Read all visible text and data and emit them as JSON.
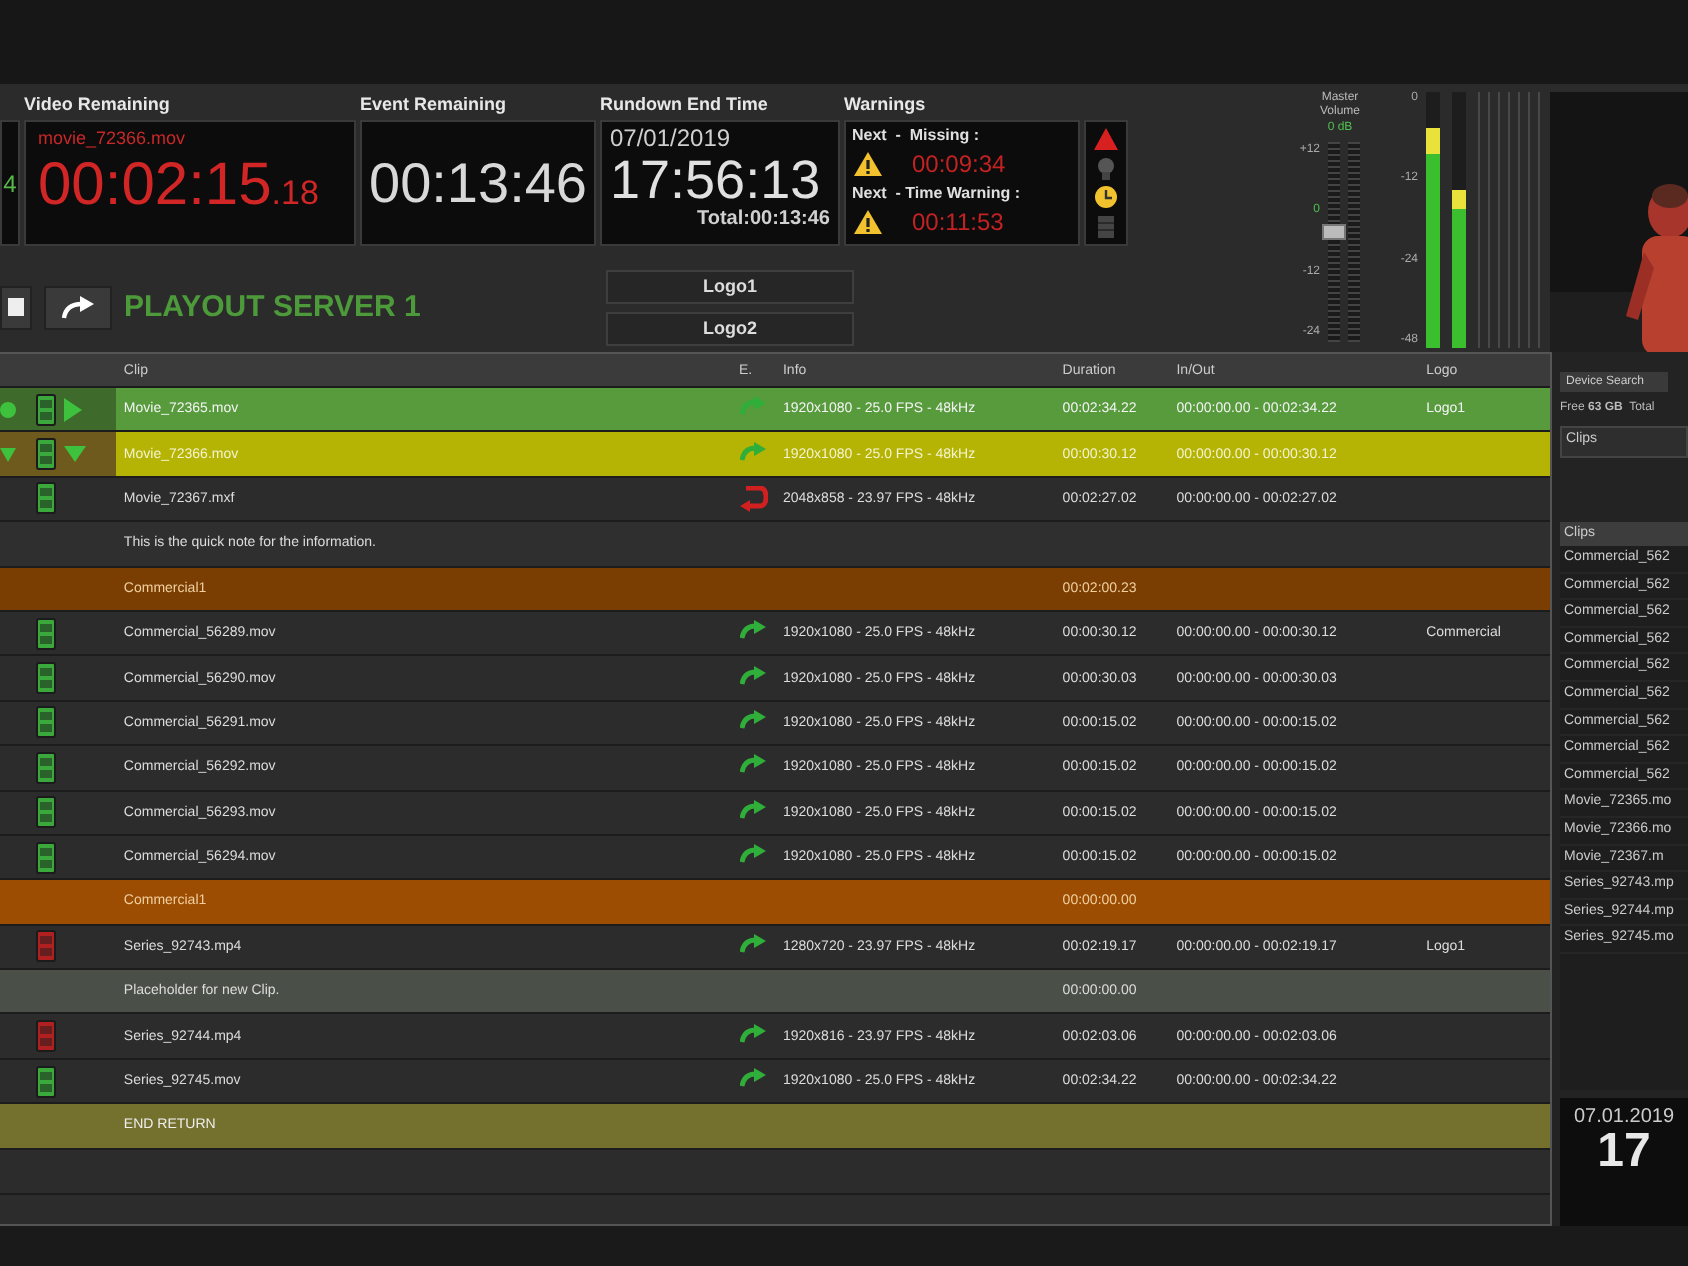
{
  "header": {
    "left_counter": "4",
    "video_remaining": {
      "label": "Video Remaining",
      "clip": "movie_72366.mov",
      "time": "00:02:15",
      "frames": ".18"
    },
    "event_remaining": {
      "label": "Event Remaining",
      "time": "00:13:46"
    },
    "rundown_end": {
      "label": "Rundown End Time",
      "date": "07/01/2019",
      "time": "17:56:13",
      "total": "Total:00:13:46"
    },
    "warnings": {
      "label": "Warnings",
      "items": [
        {
          "text": "Next  -  Missing :",
          "time": "00:09:34"
        },
        {
          "text": "Next  - Time Warning :",
          "time": "00:11:53"
        }
      ],
      "lights": [
        {
          "kind": "alarm",
          "on": true
        },
        {
          "kind": "bulb",
          "on": false
        },
        {
          "kind": "clock",
          "on": true
        },
        {
          "kind": "bar",
          "on": false
        }
      ]
    }
  },
  "controls": {
    "server_title": "PLAYOUT SERVER 1",
    "logo_buttons": [
      "Logo1",
      "Logo2"
    ]
  },
  "master_volume": {
    "label": "Master Volume",
    "value": "0 dB",
    "scale": [
      "+12",
      "0",
      "-12",
      "-24"
    ],
    "level": 0.55
  },
  "audio_meter": {
    "scale": [
      "0",
      "-12",
      "-24",
      "-48"
    ],
    "channels": [
      {
        "level": 0.86
      },
      {
        "level": 0.62
      }
    ]
  },
  "rundown": {
    "columns": [
      "Clip",
      "E.",
      "Info",
      "Duration",
      "In/Out",
      "Logo"
    ],
    "rows": [
      {
        "kind": "clip",
        "playing": true,
        "cued": false,
        "media_missing": false,
        "transition_error": false,
        "clip": "Movie_72365.mov",
        "info": "1920x1080 - 25.0 FPS - 48kHz",
        "duration": "00:02:34.22",
        "in_out": "00:00:00.00 - 00:02:34.22",
        "logo": "Logo1"
      },
      {
        "kind": "clip",
        "playing": false,
        "cued": true,
        "media_missing": false,
        "transition_error": false,
        "clip": "Movie_72366.mov",
        "info": "1920x1080 - 25.0 FPS - 48kHz",
        "duration": "00:00:30.12",
        "in_out": "00:00:00.00 - 00:00:30.12"
      },
      {
        "kind": "clip",
        "playing": false,
        "cued": false,
        "media_missing": false,
        "transition_error": true,
        "clip": "Movie_72367.mxf",
        "info": "2048x858 - 23.97 FPS - 48kHz",
        "duration": "00:02:27.02",
        "in_out": "00:00:00.00 - 00:02:27.02"
      },
      {
        "kind": "note",
        "clip": "This is the quick note for the information."
      },
      {
        "kind": "group",
        "color": "#7a3e02",
        "clip": "Commercial1",
        "duration": "00:02:00.23"
      },
      {
        "kind": "clip",
        "playing": false,
        "cued": false,
        "media_missing": false,
        "transition_error": false,
        "clip": "Commercial_56289.mov",
        "info": "1920x1080 - 25.0 FPS - 48kHz",
        "duration": "00:00:30.12",
        "in_out": "00:00:00.00 - 00:00:30.12",
        "logo": "Commercial"
      },
      {
        "kind": "clip",
        "playing": false,
        "cued": false,
        "media_missing": false,
        "transition_error": false,
        "clip": "Commercial_56290.mov",
        "info": "1920x1080 - 25.0 FPS - 48kHz",
        "duration": "00:00:30.03",
        "in_out": "00:00:00.00 - 00:00:30.03"
      },
      {
        "kind": "clip",
        "playing": false,
        "cued": false,
        "media_missing": false,
        "transition_error": false,
        "clip": "Commercial_56291.mov",
        "info": "1920x1080 - 25.0 FPS - 48kHz",
        "duration": "00:00:15.02",
        "in_out": "00:00:00.00 - 00:00:15.02"
      },
      {
        "kind": "clip",
        "playing": false,
        "cued": false,
        "media_missing": false,
        "transition_error": false,
        "clip": "Commercial_56292.mov",
        "info": "1920x1080 - 25.0 FPS - 48kHz",
        "duration": "00:00:15.02",
        "in_out": "00:00:00.00 - 00:00:15.02"
      },
      {
        "kind": "clip",
        "playing": false,
        "cued": false,
        "media_missing": false,
        "transition_error": false,
        "clip": "Commercial_56293.mov",
        "info": "1920x1080 - 25.0 FPS - 48kHz",
        "duration": "00:00:15.02",
        "in_out": "00:00:00.00 - 00:00:15.02"
      },
      {
        "kind": "clip",
        "playing": false,
        "cued": false,
        "media_missing": false,
        "transition_error": false,
        "clip": "Commercial_56294.mov",
        "info": "1920x1080 - 25.0 FPS - 48kHz",
        "duration": "00:00:15.02",
        "in_out": "00:00:00.00 - 00:00:15.02"
      },
      {
        "kind": "group",
        "color": "#9c4d02",
        "clip": "Commercial1",
        "duration": "00:00:00.00"
      },
      {
        "kind": "clip",
        "playing": false,
        "cued": false,
        "media_missing": true,
        "transition_error": false,
        "clip": "Series_92743.mp4",
        "info": "1280x720 - 23.97 FPS - 48kHz",
        "duration": "00:02:19.17",
        "in_out": "00:00:00.00 - 00:02:19.17",
        "logo": "Logo1"
      },
      {
        "kind": "placeholder",
        "clip": "Placeholder for new Clip.",
        "duration": "00:00:00.00"
      },
      {
        "kind": "clip",
        "playing": false,
        "cued": false,
        "media_missing": true,
        "transition_error": false,
        "clip": "Series_92744.mp4",
        "info": "1920x816 - 23.97 FPS - 48kHz",
        "duration": "00:02:03.06",
        "in_out": "00:00:00.00 - 00:02:03.06"
      },
      {
        "kind": "clip",
        "playing": false,
        "cued": false,
        "media_missing": false,
        "transition_error": false,
        "clip": "Series_92745.mov",
        "info": "1920x1080 - 25.0 FPS - 48kHz",
        "duration": "00:02:34.22",
        "in_out": "00:00:00.00 - 00:02:34.22"
      },
      {
        "kind": "end",
        "clip": "END RETURN"
      }
    ]
  },
  "side_panel": {
    "tab": "Device Search",
    "storage": "Free **63 GB**  Total",
    "filter": "Clips",
    "list_header": "Clips",
    "items": [
      "Commercial_562",
      "Commercial_562",
      "Commercial_562",
      "Commercial_562",
      "Commercial_562",
      "Commercial_562",
      "Commercial_562",
      "Commercial_562",
      "Commercial_562",
      "Movie_72365.mo",
      "Movie_72366.mo",
      "Movie_72367.m",
      "Series_92743.mp",
      "Series_92744.mp",
      "Series_92745.mo"
    ],
    "date": "07.01.2019",
    "time": "17"
  }
}
